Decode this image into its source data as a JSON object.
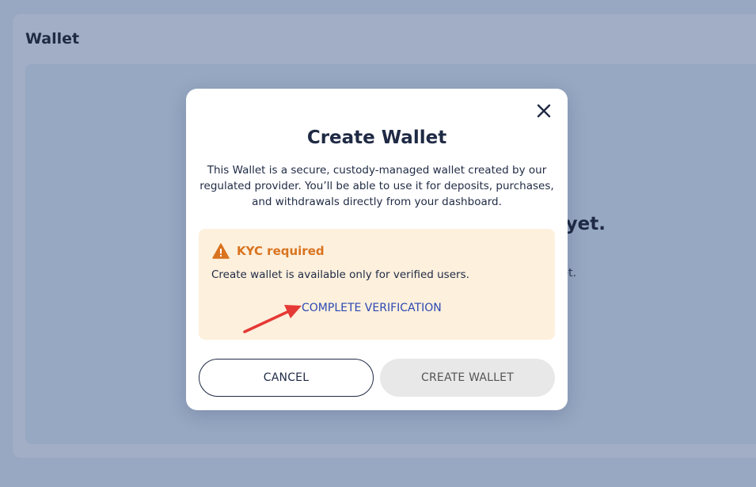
{
  "page": {
    "title": "Wallet",
    "empty_title_partial": "yet.",
    "empty_subtitle_partial": "et."
  },
  "modal": {
    "title": "Create Wallet",
    "description": "This Wallet is a secure, custody-managed wallet created by our regulated provider. You’ll be able to use it for deposits, purchases, and withdrawals directly from your dashboard.",
    "close_icon": "close-icon",
    "kyc": {
      "icon": "warning-icon",
      "title": "KYC required",
      "message": "Create wallet is available only for verified users.",
      "link_label": "COMPLETE VERIFICATION"
    },
    "buttons": {
      "cancel_label": "CANCEL",
      "create_label": "CREATE WALLET",
      "create_disabled": true
    }
  },
  "colors": {
    "backdrop": "#98a8c2",
    "kyc_background": "#fdf0dd",
    "warning_accent": "#d9731f",
    "link": "#2b49b3",
    "annotation_arrow": "#e53935"
  }
}
